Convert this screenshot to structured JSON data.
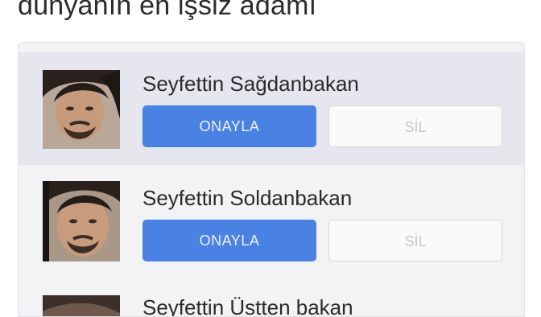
{
  "caption": "dünyanın en işsiz adamı",
  "requests": [
    {
      "name": "Seyfettin Sağdanbakan",
      "confirm_label": "ONAYLA",
      "delete_label": "SİL"
    },
    {
      "name": "Seyfettin Soldanbakan",
      "confirm_label": "ONAYLA",
      "delete_label": "SİL"
    },
    {
      "name": "Seyfettin Üstten bakan"
    }
  ],
  "colors": {
    "confirm_button": "#4a82e4",
    "highlight_row": "#e6e7ee",
    "card_background": "#f3f3f5"
  }
}
